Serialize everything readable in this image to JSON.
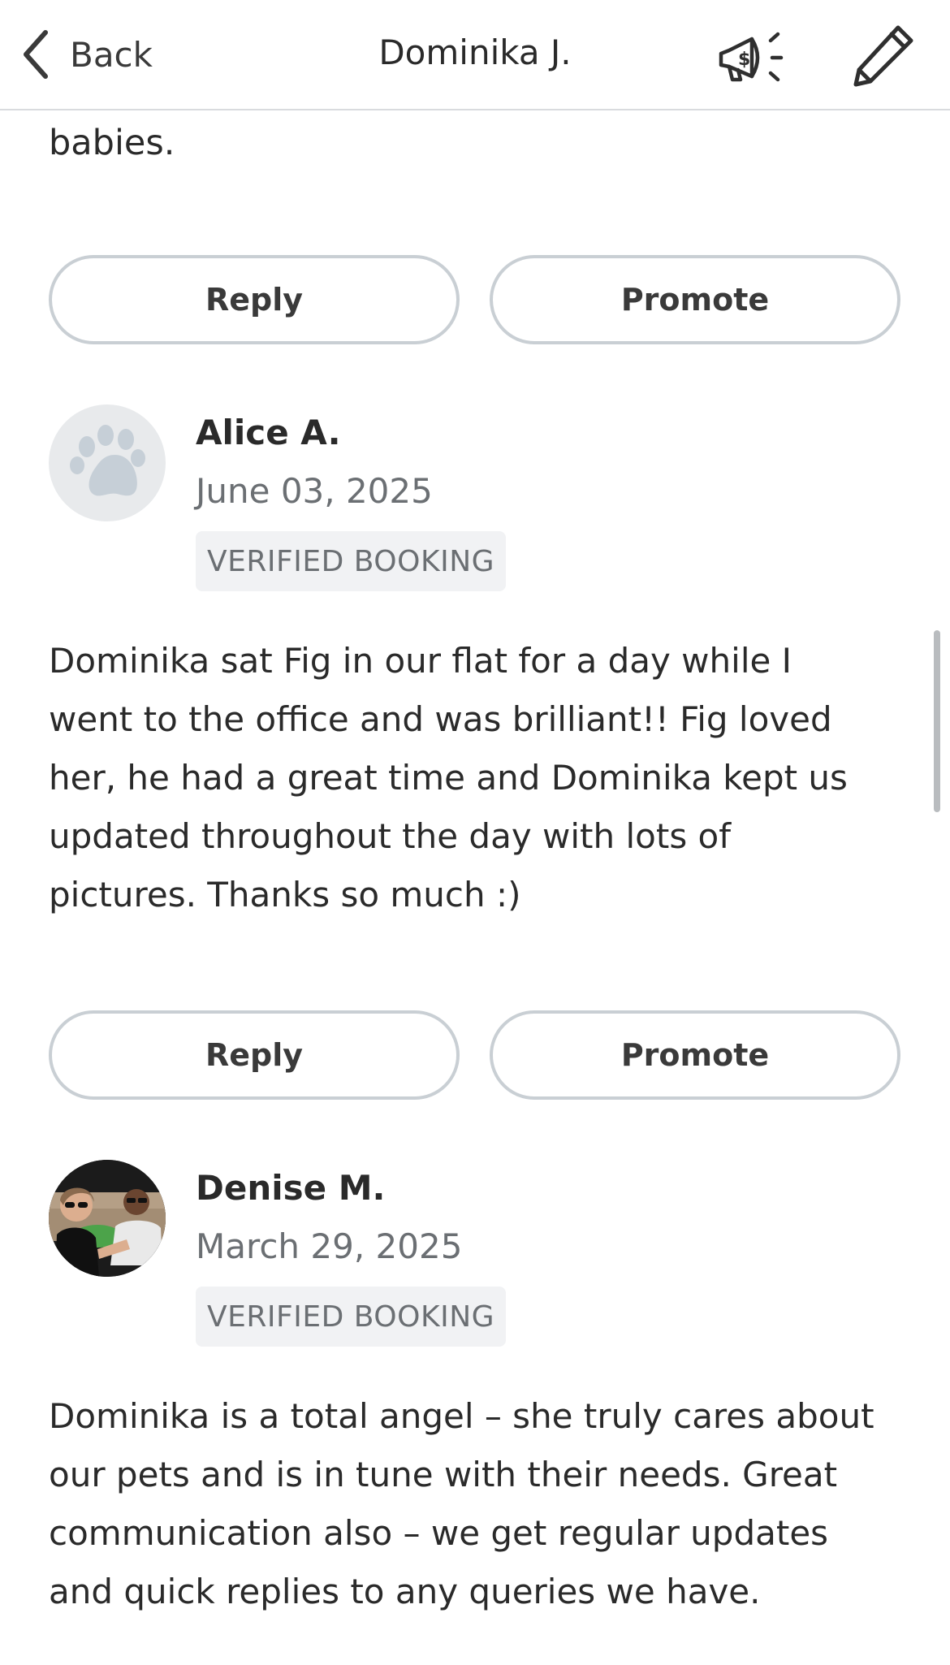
{
  "header": {
    "back_label": "Back",
    "title": "Dominika J.",
    "promote_icon": "megaphone-dollar-icon",
    "edit_icon": "pencil-icon"
  },
  "previous_review_tail": "babies.",
  "reviews": [
    {
      "reply_label": "Reply",
      "promote_label": "Promote"
    },
    {
      "name": "Alice A.",
      "date": "June 03, 2025",
      "badge": "VERIFIED BOOKING",
      "avatar": "paw-placeholder",
      "lines": [
        "Dominika sat Fig in our flat for a day while I",
        "went to the office and was brilliant!! Fig loved",
        "her, he had a great time and Dominika kept us",
        "updated throughout the day with lots of",
        "pictures. Thanks so much :)"
      ],
      "reply_label": "Reply",
      "promote_label": "Promote"
    },
    {
      "name": "Denise M.",
      "date": "March 29, 2025",
      "badge": "VERIFIED BOOKING",
      "avatar": "user-photo",
      "lines": [
        "Dominika is a total angel – she truly cares about",
        "our pets and is in tune with their needs. Great",
        "communication also – we get regular updates",
        "and quick replies to any queries we have."
      ]
    }
  ]
}
